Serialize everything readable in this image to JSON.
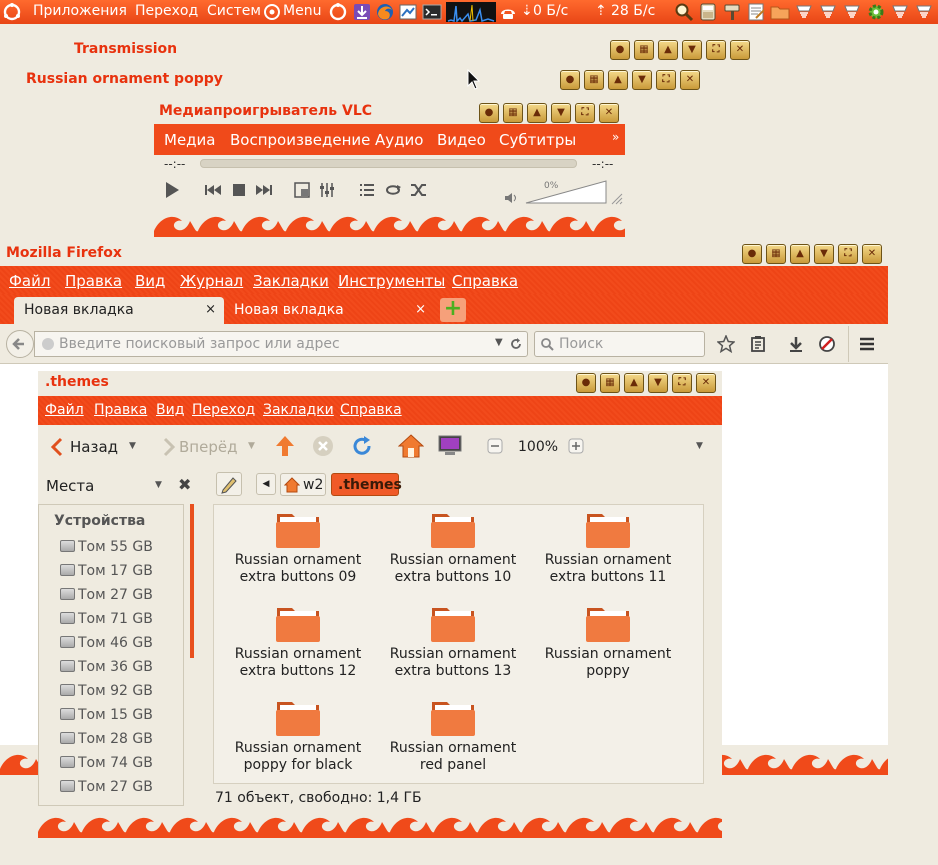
{
  "panel": {
    "apps": "Приложения",
    "places": "Переход",
    "system": "Систем",
    "menu": "Menu",
    "net_speed": "0 Б/с",
    "upload_speed": "28 Б/с"
  },
  "desktop": {
    "transmission_title": "Transmission",
    "poppy_title": "Russian ornament poppy"
  },
  "vlc": {
    "title": "Медиапроигрыватель VLC",
    "menu": [
      "Медиа",
      "Воспроизведение",
      "Аудио",
      "Видео",
      "Субтитры"
    ],
    "more": "»",
    "time_left": "--:--",
    "time_right": "--:--",
    "volume": "0%",
    "volume_level": 0
  },
  "firefox": {
    "title": "Mozilla Firefox",
    "menu": [
      "Файл",
      "Правка",
      "Вид",
      "Журнал",
      "Закладки",
      "Инструменты",
      "Справка"
    ],
    "tabs": [
      {
        "label": "Новая вкладка",
        "close": "×",
        "active": true
      },
      {
        "label": "Новая вкладка",
        "close": "×",
        "active": false
      }
    ],
    "new_tab": "+",
    "url_placeholder": "Введите поисковый запрос или адрес",
    "search_placeholder": "Поиск"
  },
  "nautilus": {
    "title": ".themes",
    "menu": [
      "Файл",
      "Правка",
      "Вид",
      "Переход",
      "Закладки",
      "Справка"
    ],
    "back": "Назад",
    "forward": "Вперёд",
    "zoom": "100%",
    "places": "Места",
    "crumbs": [
      "w2",
      ".themes"
    ],
    "devices_header": "Устройства",
    "devices": [
      "Том 55 GB",
      "Том 17 GB",
      "Том 27 GB",
      "Том 71 GB",
      "Том 46 GB",
      "Том 36 GB",
      "Том 92 GB",
      "Том 15 GB",
      "Том 28 GB",
      "Том 74 GB",
      "Том 27 GB"
    ],
    "folders": [
      [
        "Russian ornament",
        "extra buttons 09"
      ],
      [
        "Russian ornament",
        "extra buttons 10"
      ],
      [
        "Russian ornament",
        "extra buttons 11"
      ],
      [
        "Russian ornament",
        "extra buttons 12"
      ],
      [
        "Russian ornament",
        "extra buttons 13"
      ],
      [
        "Russian ornament",
        "poppy"
      ],
      [
        "Russian ornament",
        "poppy for black"
      ],
      [
        "Russian ornament",
        "red panel"
      ]
    ],
    "status": "71 объект, свободно: 1,4 ГБ"
  },
  "colors": {
    "accent": "#f04a1a",
    "title_text": "#e8320e",
    "background": "#efebe0"
  }
}
